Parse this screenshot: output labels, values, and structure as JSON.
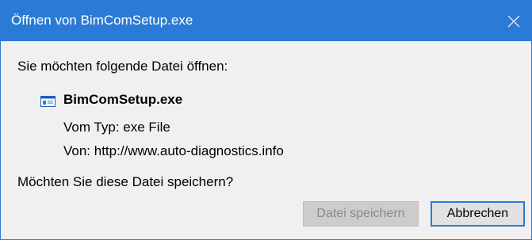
{
  "window": {
    "title": "Öffnen von BimComSetup.exe",
    "accent_color": "#2b7bd6",
    "close_icon": "close-icon"
  },
  "body": {
    "prompt": "Sie möchten folgende Datei öffnen:",
    "file": {
      "icon": "application-file-icon",
      "name": "BimComSetup.exe",
      "type_line": "Vom Typ: exe File",
      "source_line": "Von: http://www.auto-diagnostics.info"
    },
    "question": "Möchten Sie diese Datei speichern?"
  },
  "buttons": {
    "save_label": "Datei speichern",
    "save_enabled": false,
    "cancel_label": "Abbrechen"
  }
}
